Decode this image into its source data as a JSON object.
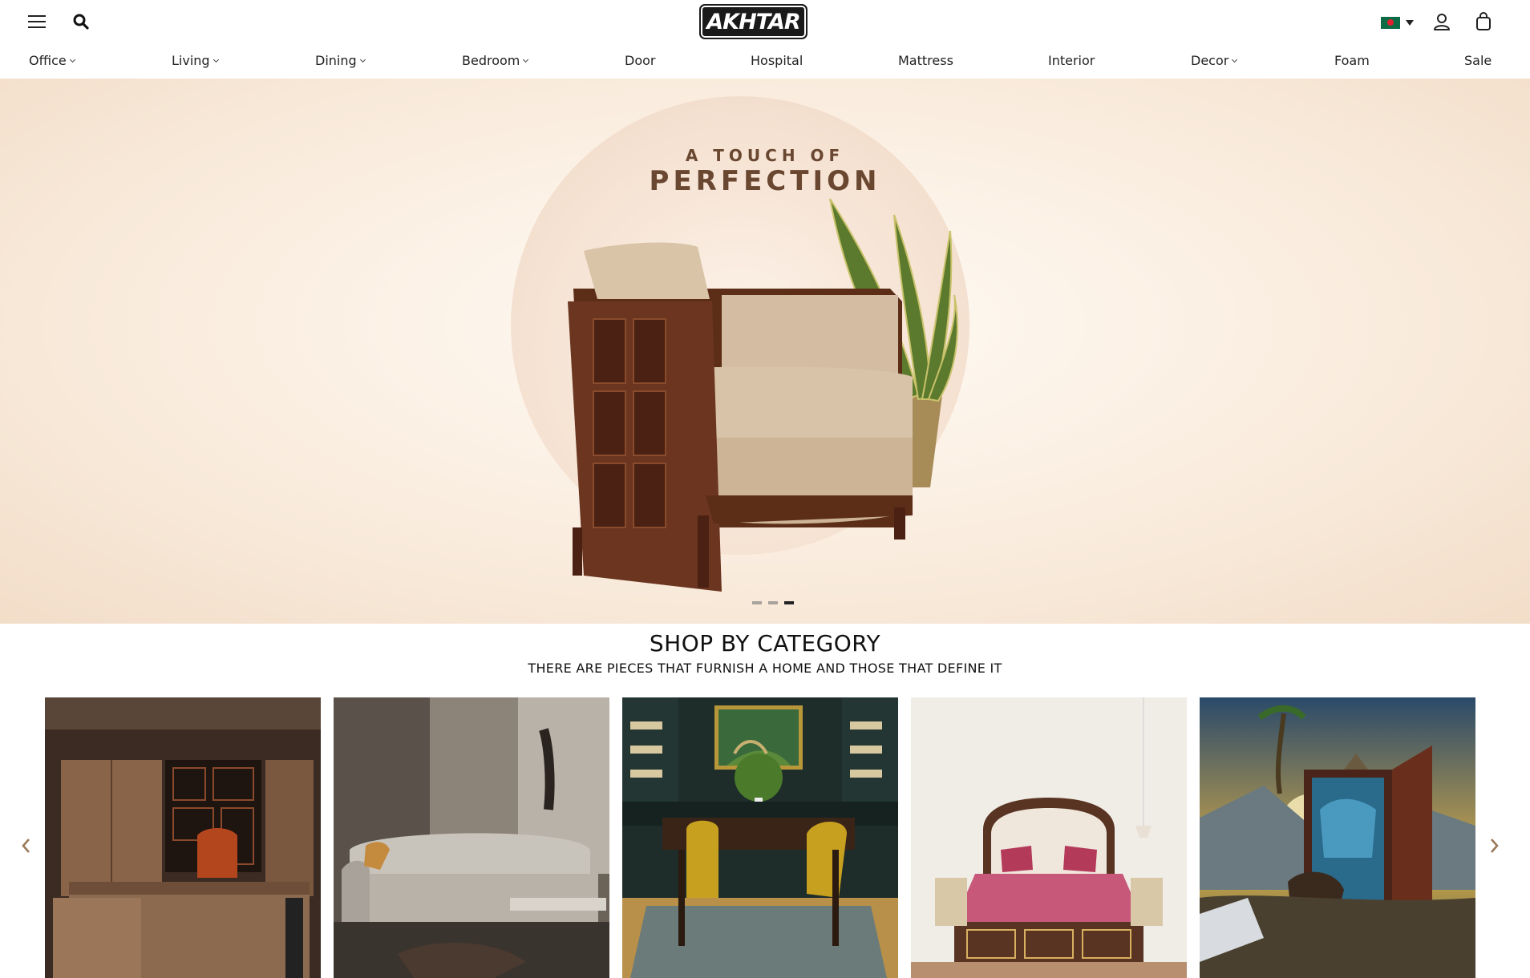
{
  "header": {
    "logo_text": "AKHTAR",
    "menu_icon": "hamburger-menu-icon",
    "search_icon": "search-icon",
    "country_flag": "bangladesh-flag-icon",
    "account_icon": "user-icon",
    "cart_icon": "shopping-bag-icon"
  },
  "nav": {
    "items": [
      {
        "label": "Office",
        "dropdown": true
      },
      {
        "label": "Living",
        "dropdown": true
      },
      {
        "label": "Dining",
        "dropdown": true
      },
      {
        "label": "Bedroom",
        "dropdown": true
      },
      {
        "label": "Door",
        "dropdown": false
      },
      {
        "label": "Hospital",
        "dropdown": false
      },
      {
        "label": "Mattress",
        "dropdown": false
      },
      {
        "label": "Interior",
        "dropdown": false
      },
      {
        "label": "Decor",
        "dropdown": true
      },
      {
        "label": "Foam",
        "dropdown": false
      },
      {
        "label": "Sale",
        "dropdown": false
      }
    ]
  },
  "hero": {
    "line1": "A TOUCH OF",
    "line2": "PERFECTION",
    "slides_total": 3,
    "active_slide": 3
  },
  "category": {
    "title": "SHOP BY CATEGORY",
    "subtitle": "THERE ARE PIECES THAT FURNISH A HOME AND THOSE THAT DEFINE IT",
    "prev_icon": "chevron-left-icon",
    "next_icon": "chevron-right-icon",
    "cards": [
      "office",
      "living",
      "dining",
      "bedroom",
      "door"
    ]
  },
  "colors": {
    "accent_brown": "#6a4730",
    "text_dark": "#222222",
    "arrow": "#9a7a5a"
  }
}
